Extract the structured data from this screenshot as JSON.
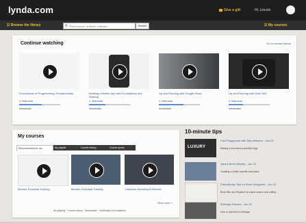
{
  "header": {
    "logo": "lynda.com",
    "gift_label": "Give a gift",
    "user_label": "Hi, Lincoln",
    "browse_label": "Browse the library",
    "search_placeholder": "Find courses, authors, software",
    "search_button": "Search",
    "my_courses_label": "My courses"
  },
  "continue_watching": {
    "title": "Continue watching",
    "link": "Go to course history",
    "items": [
      {
        "title": "Foundations of Programming: Fundamentals",
        "meta": "✔ View more",
        "progress": 0.55,
        "foot": "Introduction"
      },
      {
        "title": "Building a Mobile App with Foundations and Sharing",
        "meta": "✔ View more",
        "progress": 0.4,
        "foot": "Introduction"
      },
      {
        "title": "Up and Running with Google Glass",
        "meta": "✔ View more",
        "progress": 0.6,
        "foot": "Introduction"
      },
      {
        "title": "Up and Running with Moto 360",
        "meta": "✔ View more",
        "progress": 0.35,
        "foot": "Introduction"
      }
    ]
  },
  "my_courses": {
    "title": "My courses",
    "tabs": [
      "Recommended for me",
      "My playlist",
      "Course history",
      "Course queue"
    ],
    "items": [
      {
        "title": "Blender Essential Training"
      },
      {
        "title": "Blender Essential Training"
      },
      {
        "title": "Character Modeling in Blender"
      }
    ],
    "view_more": "View more »",
    "footer": "All playlists · Course history · Bookmarks · Certificates of completion"
  },
  "tips": {
    "title": "10-minute tips",
    "items": [
      {
        "thumb_label": "LUXURY",
        "title": "Fast Playground with Sam Masters - Jun 24",
        "desc": "Making a document-controlled logo"
      },
      {
        "thumb_label": "",
        "title": "James Bond Weekly - Jun 23",
        "desc": "Creating a Quiller-specific document"
      },
      {
        "thumb_label": "",
        "title": "PhotoBuddy Tips for Book Designers - Jun 22",
        "desc": "Book filler and Replace for easier search and editing"
      },
      {
        "thumb_label": "",
        "title": "InDesign Secrets - Jun 22",
        "desc": "How to add text to InDesign"
      }
    ]
  }
}
